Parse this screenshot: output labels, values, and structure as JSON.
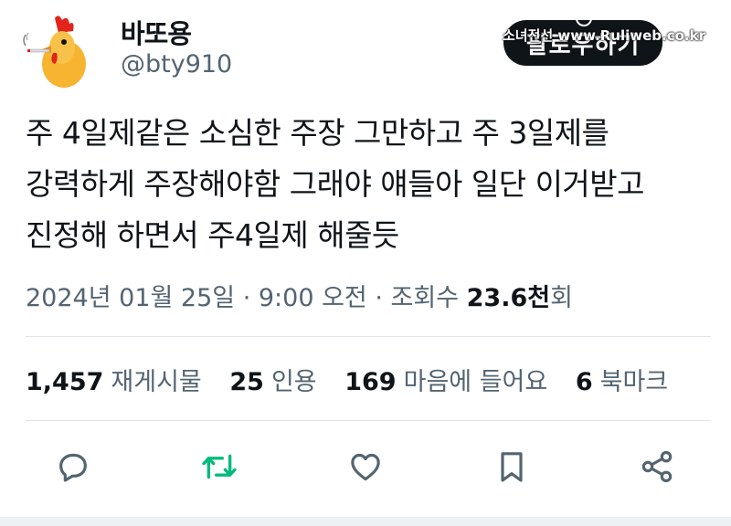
{
  "user": {
    "display_name": "바또용",
    "handle": "@bty910"
  },
  "follow_button": "팔로우하기",
  "watermark": "소녀전선 www.Ruliweb.co.kr",
  "tweet": {
    "lines": [
      "주 4일제같은 소심한 주장 그만하고 주 3일제를",
      "강력하게 주장해야함 그래야 얘들아 일단 이거받고",
      "진정해 하면서 주4일제 해줄듯"
    ]
  },
  "meta": {
    "date": "2024년 01월 25일",
    "separator1": " · ",
    "time": "9:00 오전",
    "separator2": " · ",
    "views_label": "조회수 ",
    "views_count": "23.6천",
    "views_suffix": "회"
  },
  "stats": {
    "retweets_count": "1,457",
    "retweets_label": "재게시물",
    "quotes_count": "25",
    "quotes_label": "인용",
    "likes_count": "169",
    "likes_label": "마음에 들어요",
    "bookmarks_count": "6",
    "bookmarks_label": "북마크"
  },
  "icons": {
    "reply": "reply-icon",
    "retweet": "retweet-icon",
    "like": "heart-icon",
    "bookmark": "bookmark-icon",
    "share": "share-icon"
  },
  "colors": {
    "retweet_green": "#00ba7c",
    "secondary_text": "#536471",
    "primary_text": "#0f1419"
  }
}
